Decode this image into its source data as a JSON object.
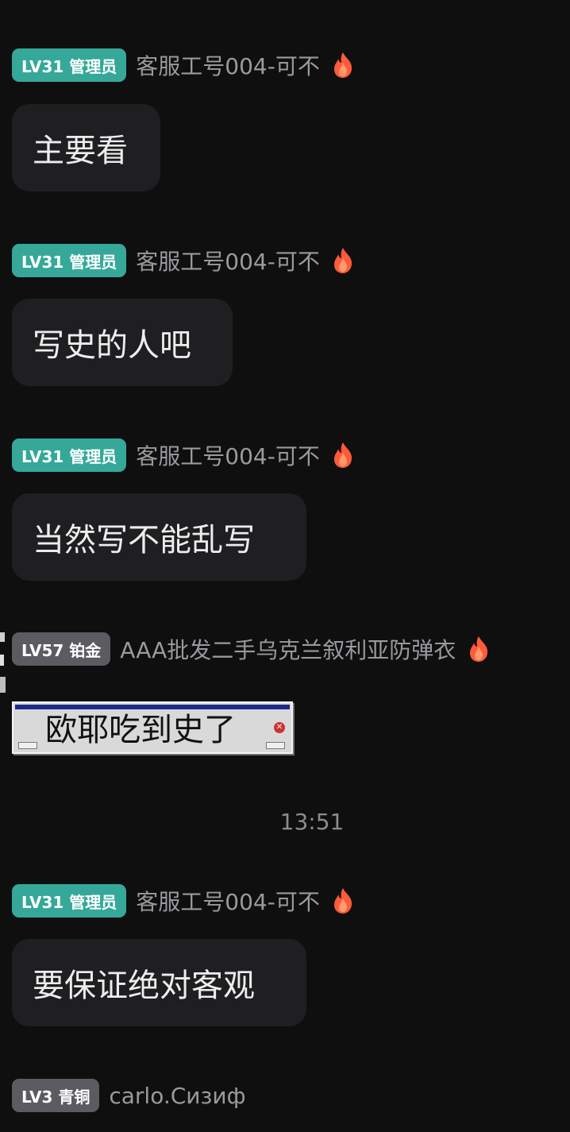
{
  "messages": [
    {
      "badge": "LV31 管理员",
      "nickname": "客服工号004-可不",
      "text": "主要看"
    },
    {
      "badge": "LV31 管理员",
      "nickname": "客服工号004-可不",
      "text": "写史的人吧"
    },
    {
      "badge": "LV31 管理员",
      "nickname": "客服工号004-可不",
      "text": "当然写不能乱写"
    },
    {
      "badge": "LV57 铂金",
      "nickname": "AAA批发二手乌克兰叙利亚防弹衣",
      "sticker_text": "欧耶吃到史了"
    },
    {
      "badge": "LV31 管理员",
      "nickname": "客服工号004-可不",
      "text": "要保证绝对客观"
    },
    {
      "badge": "LV3 青铜",
      "nickname": "carlo.Сизиф"
    }
  ],
  "timestamp": "13:51",
  "icons": {
    "title_icon": "flame-icon"
  },
  "colors": {
    "background": "#0f0f10",
    "admin_badge": "#35a899",
    "gray_badge": "#5b5b60",
    "bubble": "#1f1f22",
    "nickname": "#9a9a9e"
  }
}
